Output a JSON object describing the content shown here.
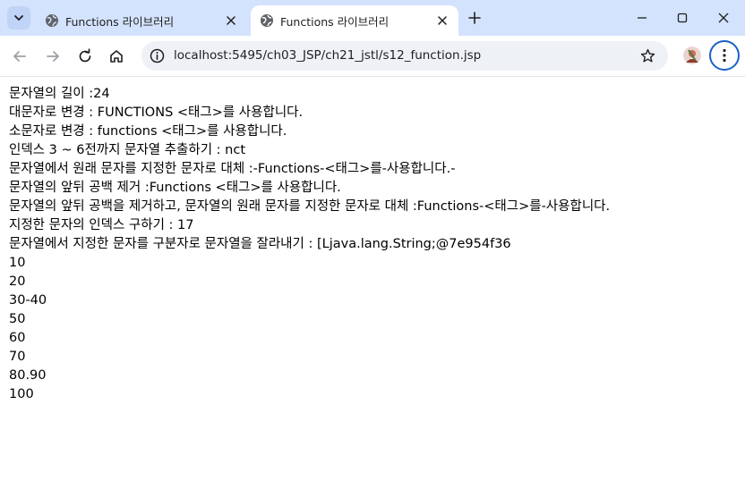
{
  "browser": {
    "tabs": [
      {
        "title": "Functions 라이브러리",
        "active": false
      },
      {
        "title": "Functions 라이브러리",
        "active": true
      }
    ],
    "url": "localhost:5495/ch03_JSP/ch21_jstl/s12_function.jsp",
    "accent": "#1a62c4",
    "tabbar_color": "#d3e3fd"
  },
  "page": {
    "lines": [
      "문자열의 길이 :24",
      "대문자로 변경 : FUNCTIONS <태그>를 사용합니다.",
      "소문자로 변경 : functions <태그>를 사용합니다.",
      "인덱스 3 ~ 6전까지 문자열 추출하기 : nct",
      "문자열에서 원래 문자를 지정한 문자로 대체 :-Functions-<태그>를-사용합니다.-",
      "문자열의 앞뒤 공백 제거 :Functions <태그>를 사용합니다.",
      "문자열의 앞뒤 공백을 제거하고, 문자열의 원래 문자를 지정한 문자로 대체 :Functions-<태그>를-사용합니다.",
      "지정한 문자의 인덱스 구하기 : 17",
      "문자열에서 지정한 문자를 구분자로 문자열을 잘라내기 : [Ljava.lang.String;@7e954f36",
      "10",
      "20",
      "30-40",
      "50",
      "60",
      "70",
      "80.90",
      "100"
    ]
  }
}
